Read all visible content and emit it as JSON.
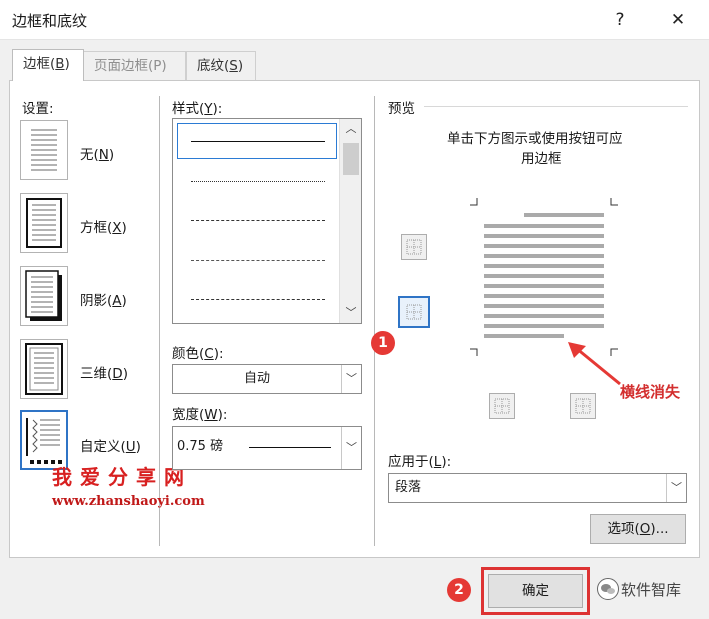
{
  "window": {
    "title": "边框和底纹",
    "help_label": "?",
    "close_label": "✕"
  },
  "tabs": [
    {
      "label": "边框(",
      "key": "B",
      "suffix": ")"
    },
    {
      "label": "页面边框(P)"
    },
    {
      "label": "底纹(",
      "key": "S",
      "suffix": ")"
    }
  ],
  "settings": {
    "heading": "设置:",
    "items": [
      {
        "label": "无(",
        "key": "N",
        "suffix": ")"
      },
      {
        "label": "方框(",
        "key": "X",
        "suffix": ")"
      },
      {
        "label": "阴影(",
        "key": "A",
        "suffix": ")"
      },
      {
        "label": "三维(",
        "key": "D",
        "suffix": ")"
      },
      {
        "label": "自定义(",
        "key": "U",
        "suffix": ")"
      }
    ]
  },
  "style": {
    "heading": "样式(",
    "key": "Y",
    "suffix": "):"
  },
  "color": {
    "heading": "颜色(",
    "key": "C",
    "suffix": "):",
    "value": "自动"
  },
  "width": {
    "heading": "宽度(",
    "key": "W",
    "suffix": "):",
    "value": "0.75 磅"
  },
  "preview": {
    "heading": "预览",
    "hint_line1": "单击下方图示或使用按钮可应",
    "hint_line2": "用边框"
  },
  "apply_to": {
    "heading": "应用于(",
    "key": "L",
    "suffix": "):",
    "value": "段落"
  },
  "options_button": {
    "label": "选项(",
    "key": "O",
    "suffix": ")..."
  },
  "ok_button": {
    "label": "确定"
  },
  "annotations": {
    "badge1": "1",
    "badge2": "2",
    "note": "横线消失",
    "watermark_cn": "我爱分享网",
    "watermark_url": "www.zhanshaoyi.com",
    "brand": "软件智库"
  },
  "colors": {
    "accent": "#2f74c6",
    "annotation_red": "#e53935",
    "panel_bg": "#ffffff",
    "dialog_bg": "#f0f0f0"
  }
}
